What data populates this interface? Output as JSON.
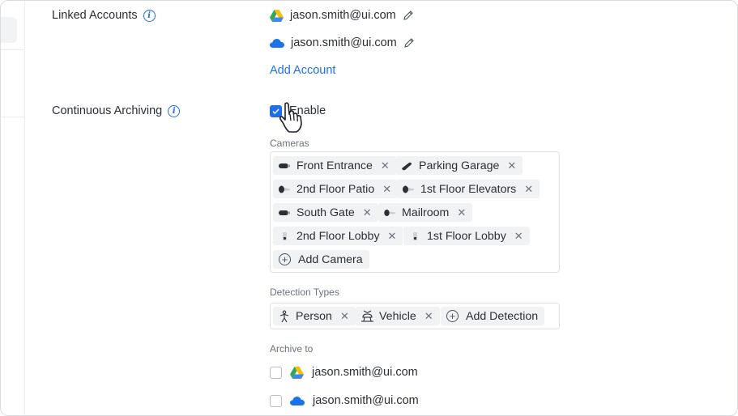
{
  "linked_accounts": {
    "label": "Linked Accounts",
    "info_icon": "info-icon",
    "accounts": [
      {
        "email": "jason.smith@ui.com",
        "icon": "google-drive-icon"
      },
      {
        "email": "jason.smith@ui.com",
        "icon": "onedrive-icon"
      }
    ],
    "add_label": "Add Account"
  },
  "continuous_archiving": {
    "label": "Continuous Archiving",
    "enable_label": "Enable",
    "enabled": true,
    "cameras_label": "Cameras",
    "cameras": [
      {
        "name": "Front Entrance",
        "icon": "bullet-camera-icon"
      },
      {
        "name": "Parking Garage",
        "icon": "ptz-camera-icon"
      },
      {
        "name": "2nd Floor Patio",
        "icon": "dome-camera-icon"
      },
      {
        "name": "1st Floor Elevators",
        "icon": "dome-camera-icon"
      },
      {
        "name": "South Gate",
        "icon": "bullet-camera-icon"
      },
      {
        "name": "Mailroom",
        "icon": "dome-camera-icon"
      },
      {
        "name": "2nd Floor Lobby",
        "icon": "doorbell-camera-icon"
      },
      {
        "name": "1st Floor Lobby",
        "icon": "doorbell-camera-icon"
      }
    ],
    "add_camera_label": "Add Camera",
    "detection_label": "Detection Types",
    "detections": [
      {
        "name": "Person",
        "icon": "person-icon"
      },
      {
        "name": "Vehicle",
        "icon": "vehicle-icon"
      }
    ],
    "add_detection_label": "Add Detection",
    "archive_to_label": "Archive to",
    "archive_targets": [
      {
        "email": "jason.smith@ui.com",
        "icon": "google-drive-icon",
        "checked": false
      },
      {
        "email": "jason.smith@ui.com",
        "icon": "onedrive-icon",
        "checked": false
      }
    ]
  },
  "colors": {
    "accent": "#1f6feb",
    "chip_bg": "#f1f2f4",
    "text": "#2b2f36",
    "muted": "#6b7280"
  }
}
